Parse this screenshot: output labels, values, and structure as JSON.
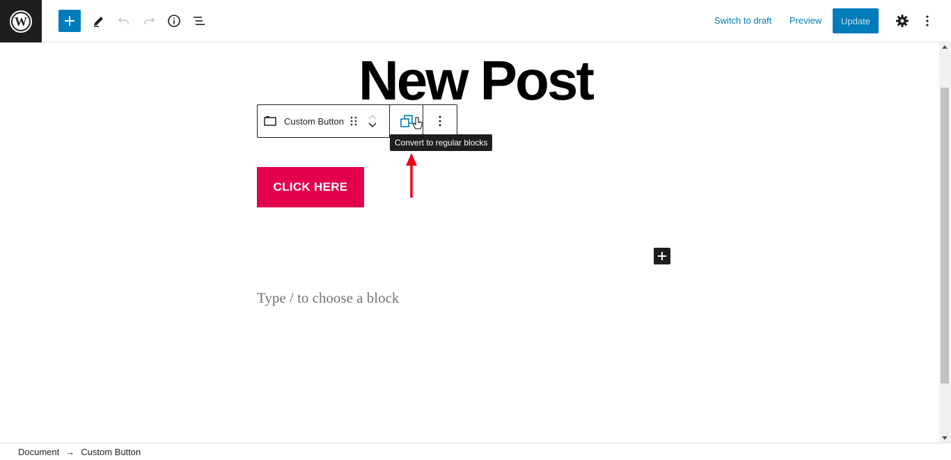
{
  "header": {
    "switch_to_draft": "Switch to draft",
    "preview": "Preview",
    "update": "Update"
  },
  "post": {
    "title": "New Post"
  },
  "block_toolbar": {
    "block_name": "Custom Button",
    "tooltip": "Convert to regular blocks"
  },
  "content": {
    "button_label": "CLICK HERE",
    "placeholder": "Type / to choose a block"
  },
  "breadcrumb": {
    "items": [
      "Document",
      "Custom Button"
    ],
    "separator": "→"
  },
  "colors": {
    "accent": "#007cba",
    "cta": "#e2004f",
    "annotation_arrow": "#e8001c"
  },
  "icons": [
    "wordpress-logo-icon",
    "plus-icon",
    "pencil-icon",
    "undo-icon",
    "redo-icon",
    "info-icon",
    "list-view-icon",
    "gear-icon",
    "more-vertical-icon",
    "block-icon",
    "drag-handle-icon",
    "move-up-icon",
    "move-down-icon",
    "convert-icon",
    "pointer-cursor-icon",
    "add-block-icon"
  ]
}
